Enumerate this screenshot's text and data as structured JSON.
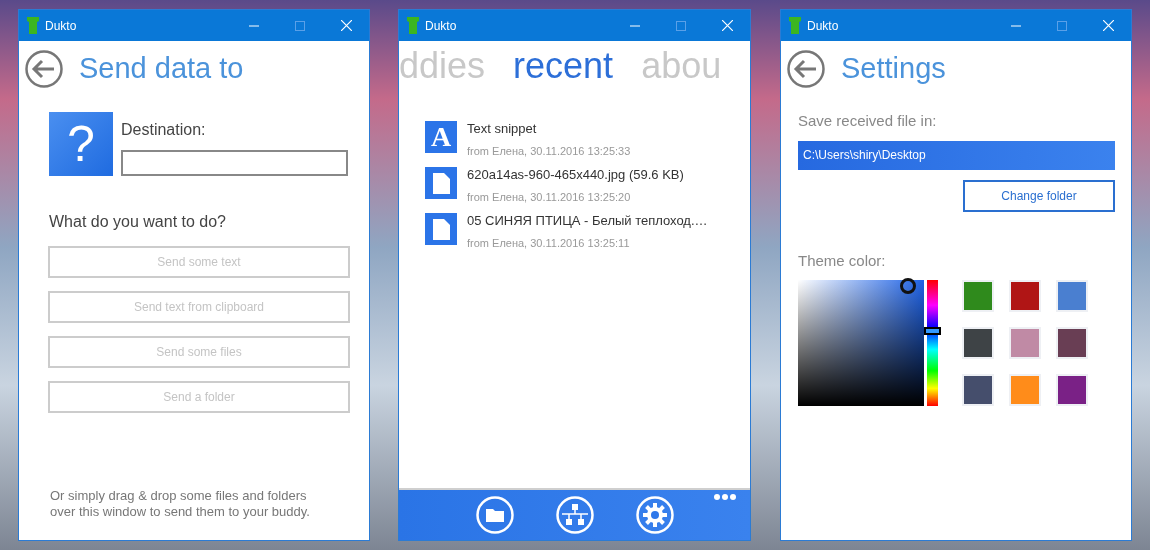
{
  "windows": [
    {
      "kind": "send",
      "title": "Dukto",
      "heading": "Send data to",
      "avatar_glyph": "?",
      "destination_label": "Destination:",
      "question": "What do you want to do?",
      "actions": [
        {
          "label": "Send some text",
          "disabled": true
        },
        {
          "label": "Send text from clipboard",
          "disabled": true
        },
        {
          "label": "Send some files",
          "disabled": true
        },
        {
          "label": "Send a folder",
          "disabled": true
        }
      ],
      "hint": "Or simply drag & drop some files and folders over this window to send them to your buddy."
    },
    {
      "kind": "recent",
      "title": "Dukto",
      "tabs": [
        {
          "label": "ddies",
          "selected": false
        },
        {
          "label": "recent",
          "selected": true
        },
        {
          "label": "abou",
          "selected": false
        }
      ],
      "items": [
        {
          "kind": "text",
          "glyph": "A",
          "name": "Text snippet",
          "meta": "from Елена, 30.11.2016 13:25:33"
        },
        {
          "kind": "file",
          "name": "620a14as-960-465x440.jpg (59.6 KB)",
          "meta": "from Елена, 30.11.2016 13:25:20"
        },
        {
          "kind": "file",
          "name": "05 СИНЯЯ ПТИЦА - Белый теплоход.…",
          "meta": "from Елена, 30.11.2016 13:25:11"
        }
      ]
    },
    {
      "kind": "settings",
      "title": "Dukto",
      "heading": "Settings",
      "folder_label": "Save received file in:",
      "folder_path": "C:\\Users\\shiry\\Desktop",
      "change_button": "Change folder",
      "theme_label": "Theme color:",
      "hue_slider": {
        "level": 0.6
      },
      "swatches": [
        {
          "color": "#2f8a1c"
        },
        {
          "color": "#b01515"
        },
        {
          "color": "#4a7fd0"
        },
        {
          "color": "#3e4346"
        },
        {
          "color": "#c08aa5"
        },
        {
          "color": "#693e54"
        },
        {
          "color": "#454e6c"
        },
        {
          "color": "#ff8c1a"
        },
        {
          "color": "#7a2186"
        }
      ]
    }
  ]
}
